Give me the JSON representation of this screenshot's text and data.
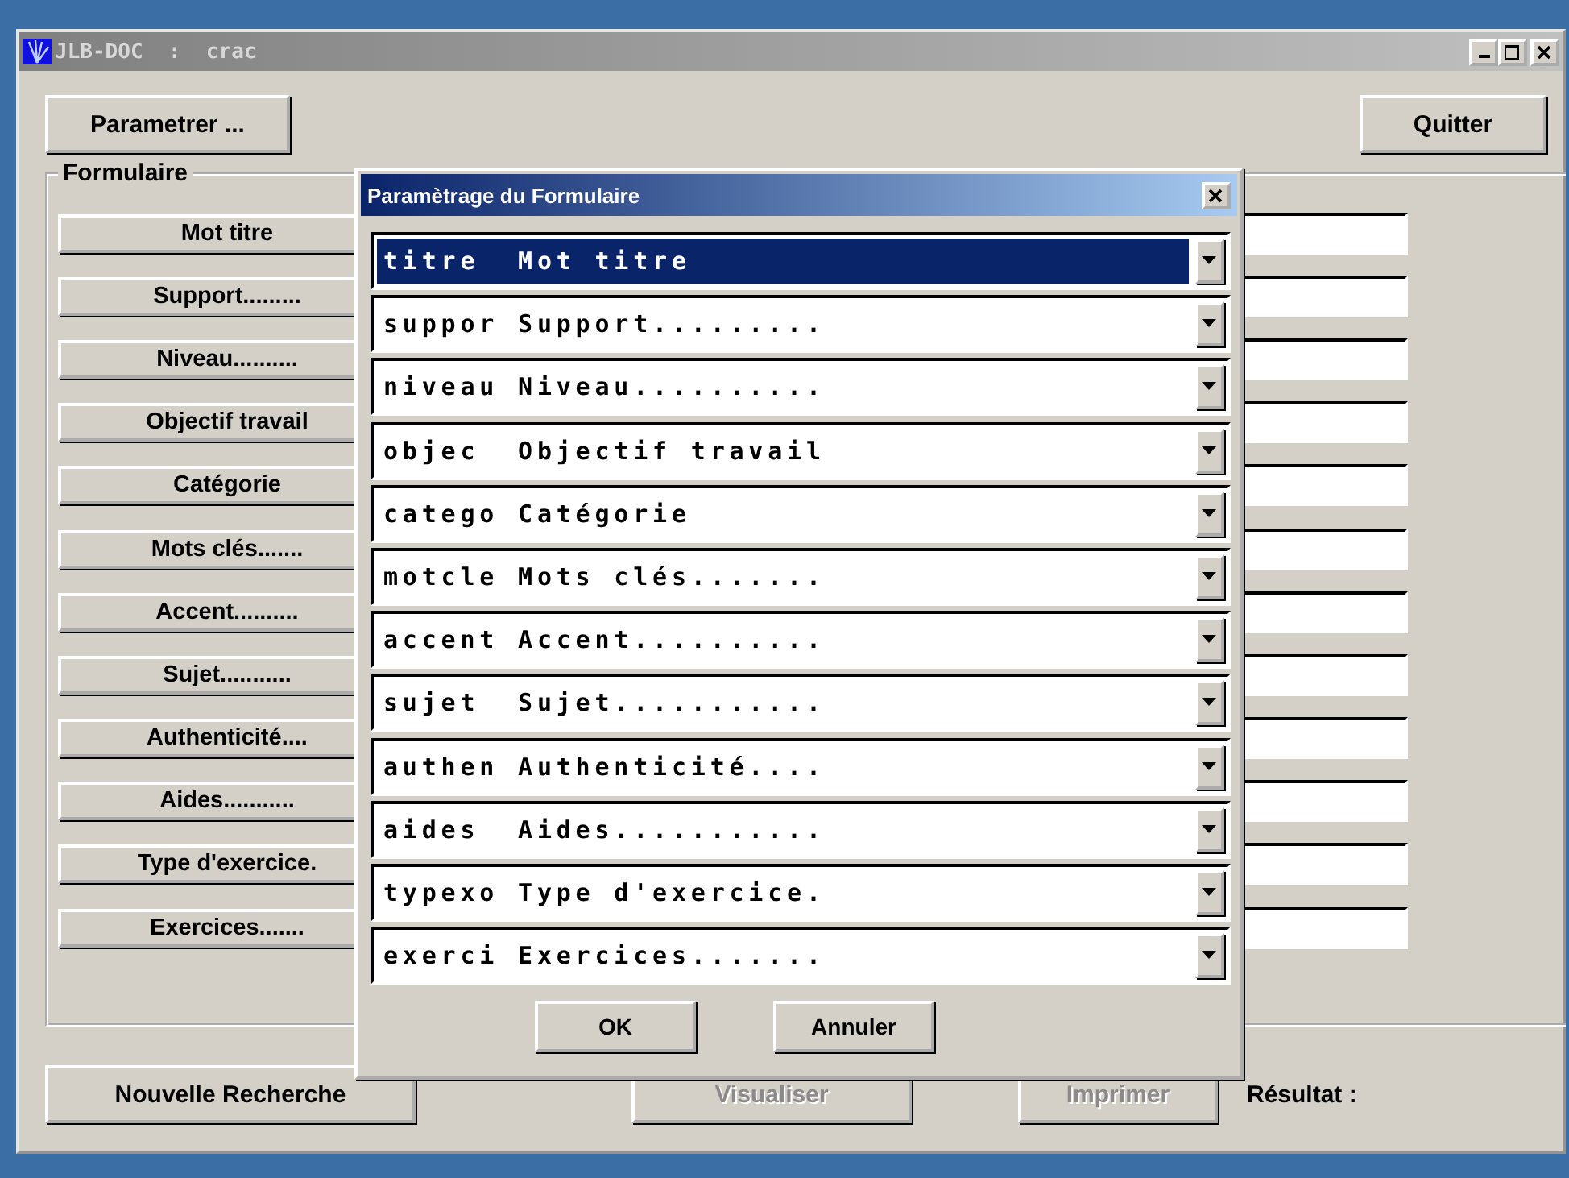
{
  "window": {
    "title": "JLB-DOC  :  crac"
  },
  "toolbar": {
    "parametrer": "Parametrer ...",
    "quitter": "Quitter"
  },
  "form": {
    "title": "Formulaire",
    "items": [
      {
        "label": "Mot titre"
      },
      {
        "label": "Support........."
      },
      {
        "label": "Niveau.........."
      },
      {
        "label": "Objectif travail"
      },
      {
        "label": "Catégorie"
      },
      {
        "label": "Mots clés......."
      },
      {
        "label": "Accent.........."
      },
      {
        "label": "Sujet..........."
      },
      {
        "label": "Authenticité...."
      },
      {
        "label": "Aides..........."
      },
      {
        "label": "Type d'exercice."
      },
      {
        "label": "Exercices......."
      }
    ]
  },
  "footer": {
    "buttons": [
      {
        "label": "Nouvelle Recherche",
        "disabled": false
      },
      {
        "label": "Visualiser",
        "disabled": true
      },
      {
        "label": "Imprimer",
        "disabled": true
      }
    ],
    "result_label": "Résultat :"
  },
  "dialog": {
    "title": "Paramètrage du Formulaire",
    "combos": [
      {
        "value": "titre  Mot titre",
        "selected": true
      },
      {
        "value": "suppor Support.........",
        "selected": false
      },
      {
        "value": "niveau Niveau..........",
        "selected": false
      },
      {
        "value": "objec  Objectif travail",
        "selected": false
      },
      {
        "value": "catego Catégorie",
        "selected": false
      },
      {
        "value": "motcle Mots clés.......",
        "selected": false
      },
      {
        "value": "accent Accent..........",
        "selected": false
      },
      {
        "value": "sujet  Sujet...........",
        "selected": false
      },
      {
        "value": "authen Authenticité....",
        "selected": false
      },
      {
        "value": "aides  Aides...........",
        "selected": false
      },
      {
        "value": "typexo Type d'exercice.",
        "selected": false
      },
      {
        "value": "exerci Exercices.......",
        "selected": false
      }
    ],
    "ok": "OK",
    "cancel": "Annuler"
  }
}
